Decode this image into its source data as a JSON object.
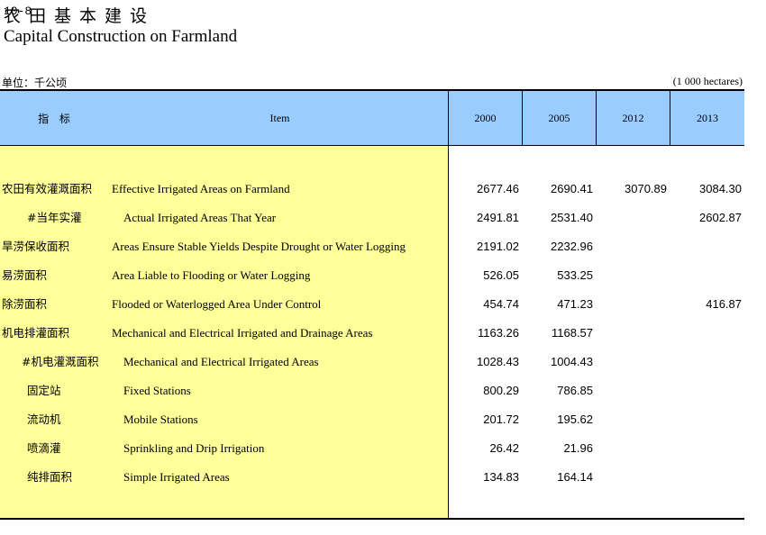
{
  "title": {
    "number": "10-8",
    "zh": "农田基本建设",
    "en": "Capital Construction on Farmland"
  },
  "unit": {
    "left": "单位：千公顷",
    "right": "(1 000 hectares)"
  },
  "columns": {
    "zh": "指 标",
    "item": "Item",
    "years": [
      "2000",
      "2005",
      "2012",
      "2013"
    ]
  },
  "rows": [
    {
      "zh": "农田有效灌溉面积",
      "en": "Effective Irrigated Areas on Farmland",
      "indent": false,
      "zh_indent": 0,
      "values": [
        "2677.46",
        "2690.41",
        "3070.89",
        "3084.30"
      ]
    },
    {
      "zh": "#当年实灌",
      "en": "Actual  Irrigated Areas That Year",
      "indent": true,
      "zh_indent": 1,
      "values": [
        "2491.81",
        "2531.40",
        "",
        "2602.87"
      ]
    },
    {
      "zh": "旱涝保收面积",
      "en": "Areas Ensure Stable Yields Despite Drought or Water Logging",
      "indent": false,
      "zh_indent": 0,
      "values": [
        "2191.02",
        "2232.96",
        "",
        ""
      ]
    },
    {
      "zh": "易涝面积",
      "en": "Area Liable to Flooding or Water Logging",
      "indent": false,
      "zh_indent": 0,
      "values": [
        "526.05",
        "533.25",
        "",
        ""
      ]
    },
    {
      "zh": "除涝面积",
      "en": "Flooded or Waterlogged Area Under Control",
      "indent": false,
      "zh_indent": 0,
      "values": [
        "454.74",
        "471.23",
        "",
        "416.87"
      ]
    },
    {
      "zh": "机电排灌面积",
      "en": "Mechanical and Electrical Irrigated and Drainage Areas",
      "indent": false,
      "zh_indent": 0,
      "values": [
        "1163.26",
        "1168.57",
        "",
        ""
      ]
    },
    {
      "zh": "#机电灌溉面积",
      "en": "Mechanical and Electrical Irrigated Areas",
      "indent": true,
      "zh_indent": 2,
      "values": [
        "1028.43",
        "1004.43",
        "",
        ""
      ]
    },
    {
      "zh": "固定站",
      "en": "Fixed Stations",
      "indent": true,
      "zh_indent": 3,
      "values": [
        "800.29",
        "786.85",
        "",
        ""
      ]
    },
    {
      "zh": "流动机",
      "en": "Mobile Stations",
      "indent": true,
      "zh_indent": 3,
      "values": [
        "201.72",
        "195.62",
        "",
        ""
      ]
    },
    {
      "zh": "喷滴灌",
      "en": "Sprinkling and Drip Irrigation",
      "indent": true,
      "zh_indent": 3,
      "values": [
        "26.42",
        "21.96",
        "",
        ""
      ]
    },
    {
      "zh": "纯排面积",
      "en": "Simple Irrigated Areas",
      "indent": true,
      "zh_indent": 3,
      "values": [
        "134.83",
        "164.14",
        "",
        ""
      ]
    }
  ],
  "colors": {
    "header_band": "#99ccff",
    "label_panel": "#ffff99"
  }
}
